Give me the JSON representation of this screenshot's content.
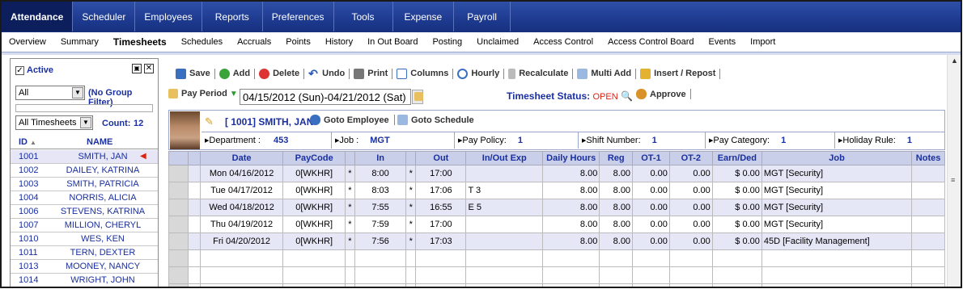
{
  "topnav": [
    "Attendance",
    "Scheduler",
    "Employees",
    "Reports",
    "Preferences",
    "Tools",
    "Expense",
    "Payroll"
  ],
  "subnav": [
    "Overview",
    "Summary",
    "Timesheets",
    "Schedules",
    "Accruals",
    "Points",
    "History",
    "In Out Board",
    "Posting",
    "Unclaimed",
    "Access Control",
    "Access Control Board",
    "Events",
    "Import"
  ],
  "left": {
    "active_label": "Active",
    "group_value": "All",
    "group_filter": "(No Group Filter)",
    "timesheets_value": "All Timesheets",
    "count_label": "Count:",
    "count": "12",
    "col_id": "ID",
    "col_name": "NAME",
    "employees": [
      {
        "id": "1001",
        "name": "SMITH, JAN"
      },
      {
        "id": "1002",
        "name": "DAILEY, KATRINA"
      },
      {
        "id": "1003",
        "name": "SMITH, PATRICIA"
      },
      {
        "id": "1004",
        "name": "NORRIS, ALICIA"
      },
      {
        "id": "1006",
        "name": "STEVENS, KATRINA"
      },
      {
        "id": "1007",
        "name": "MILLION, CHERYL"
      },
      {
        "id": "1010",
        "name": "WES, KEN"
      },
      {
        "id": "1011",
        "name": "TERN, DEXTER"
      },
      {
        "id": "1013",
        "name": "MOONEY, NANCY"
      },
      {
        "id": "1014",
        "name": "WRIGHT, JOHN"
      }
    ]
  },
  "toolbar": {
    "save": "Save",
    "add": "Add",
    "delete": "Delete",
    "undo": "Undo",
    "print": "Print",
    "columns": "Columns",
    "hourly": "Hourly",
    "recalc": "Recalculate",
    "multiadd": "Multi Add",
    "insert": "Insert / Repost"
  },
  "period": {
    "label": "Pay Period",
    "value": "04/15/2012 (Sun)-04/21/2012 (Sat)"
  },
  "status": {
    "label": "Timesheet Status:",
    "value": "OPEN",
    "approve": "Approve"
  },
  "employee": {
    "title": "[ 1001] SMITH, JAN",
    "goto_employee": "Goto Employee",
    "goto_schedule": "Goto Schedule",
    "fields": [
      {
        "label": "Department :",
        "value": "453"
      },
      {
        "label": "Job :",
        "value": "MGT"
      },
      {
        "label": "Pay Policy:",
        "value": "1"
      },
      {
        "label": "Shift Number:",
        "value": "1"
      },
      {
        "label": "Pay Category:",
        "value": "1"
      },
      {
        "label": "Holiday Rule:",
        "value": "1"
      }
    ]
  },
  "grid": {
    "headers": [
      "Date",
      "PayCode",
      "In",
      "Out",
      "In/Out Exp",
      "Daily Hours",
      "Reg",
      "OT-1",
      "OT-2",
      "Earn/Ded",
      "Job",
      "Notes"
    ],
    "rows": [
      {
        "date": "Mon 04/16/2012",
        "paycode": "0[WKHR]",
        "in": "8:00",
        "out": "17:00",
        "exp": "",
        "daily": "8.00",
        "reg": "8.00",
        "ot1": "0.00",
        "ot2": "0.00",
        "earn": "$ 0.00",
        "job": "MGT [Security]",
        "notes": ""
      },
      {
        "date": "Tue 04/17/2012",
        "paycode": "0[WKHR]",
        "in": "8:03",
        "out": "17:06",
        "exp": "T 3",
        "daily": "8.00",
        "reg": "8.00",
        "ot1": "0.00",
        "ot2": "0.00",
        "earn": "$ 0.00",
        "job": "MGT [Security]",
        "notes": ""
      },
      {
        "date": "Wed 04/18/2012",
        "paycode": "0[WKHR]",
        "in": "7:55",
        "out": "16:55",
        "exp": "E 5",
        "daily": "8.00",
        "reg": "8.00",
        "ot1": "0.00",
        "ot2": "0.00",
        "earn": "$ 0.00",
        "job": "MGT [Security]",
        "notes": ""
      },
      {
        "date": "Thu 04/19/2012",
        "paycode": "0[WKHR]",
        "in": "7:59",
        "out": "17:00",
        "exp": "",
        "daily": "8.00",
        "reg": "8.00",
        "ot1": "0.00",
        "ot2": "0.00",
        "earn": "$ 0.00",
        "job": "MGT [Security]",
        "notes": ""
      },
      {
        "date": "Fri 04/20/2012",
        "paycode": "0[WKHR]",
        "in": "7:56",
        "out": "17:03",
        "exp": "",
        "daily": "8.00",
        "reg": "8.00",
        "ot1": "0.00",
        "ot2": "0.00",
        "earn": "$ 0.00",
        "job": "45D [Facility Management]",
        "notes": ""
      }
    ]
  },
  "colors": {
    "nav": "#1d3a8f",
    "accent": "#1a2fa0",
    "open": "#dd2211",
    "row_alt": "#e5e7f6"
  }
}
